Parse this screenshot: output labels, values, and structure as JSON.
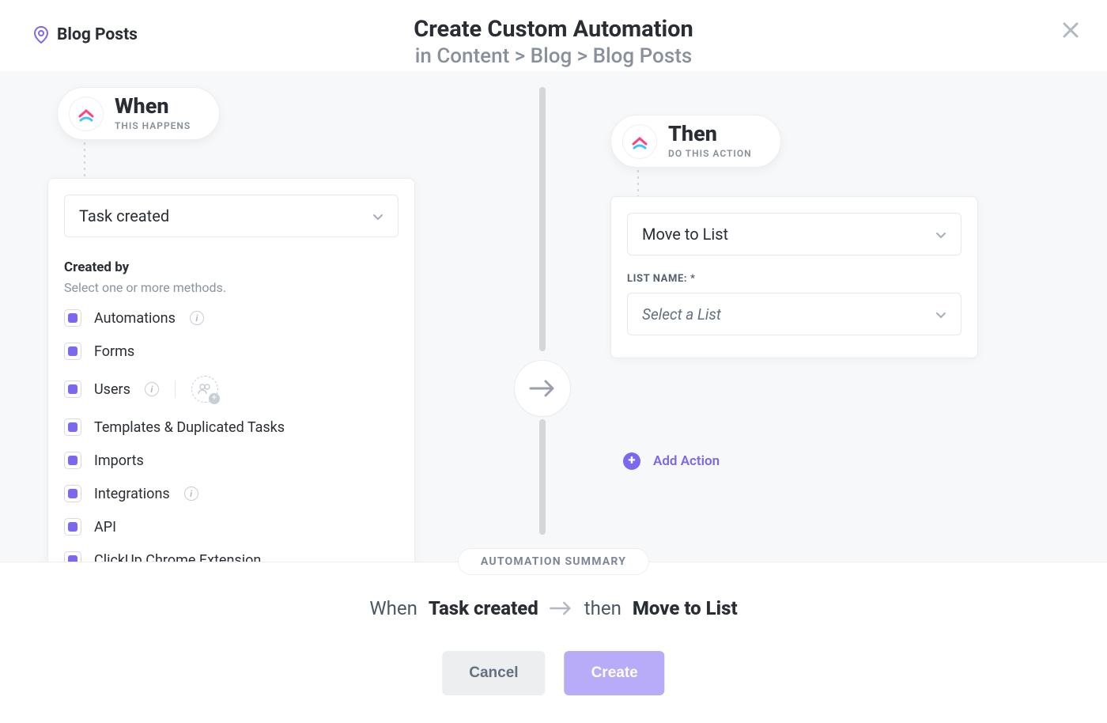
{
  "header": {
    "location_icon": "location-pin",
    "location_label": "Blog Posts",
    "title": "Create Custom Automation",
    "breadcrumb_prefix": "in",
    "breadcrumb": "Content > Blog > Blog Posts"
  },
  "when": {
    "pill_title": "When",
    "pill_sub": "THIS HAPPENS",
    "trigger_select_value": "Task created",
    "created_by_label": "Created by",
    "created_by_hint": "Select one or more methods.",
    "methods": [
      {
        "label": "Automations",
        "checked": true,
        "info": true
      },
      {
        "label": "Forms",
        "checked": true
      },
      {
        "label": "Users",
        "checked": true,
        "info": true,
        "people": true
      },
      {
        "label": "Templates & Duplicated Tasks",
        "checked": true
      },
      {
        "label": "Imports",
        "checked": true
      },
      {
        "label": "Integrations",
        "checked": true,
        "info": true
      },
      {
        "label": "API",
        "checked": true
      },
      {
        "label": "ClickUp Chrome Extension",
        "checked": true
      }
    ]
  },
  "then": {
    "pill_title": "Then",
    "pill_sub": "DO THIS ACTION",
    "action_select_value": "Move to List",
    "list_name_label": "LIST NAME: *",
    "list_select_placeholder": "Select a List",
    "add_action_label": "Add Action"
  },
  "summary": {
    "badge": "AUTOMATION SUMMARY",
    "when_word": "When",
    "when_value": "Task created",
    "then_word": "then",
    "then_value": "Move to List"
  },
  "buttons": {
    "cancel": "Cancel",
    "create": "Create"
  },
  "colors": {
    "accent": "#7b68ee",
    "accent_light": "#b8abf8",
    "muted": "#89909b"
  }
}
